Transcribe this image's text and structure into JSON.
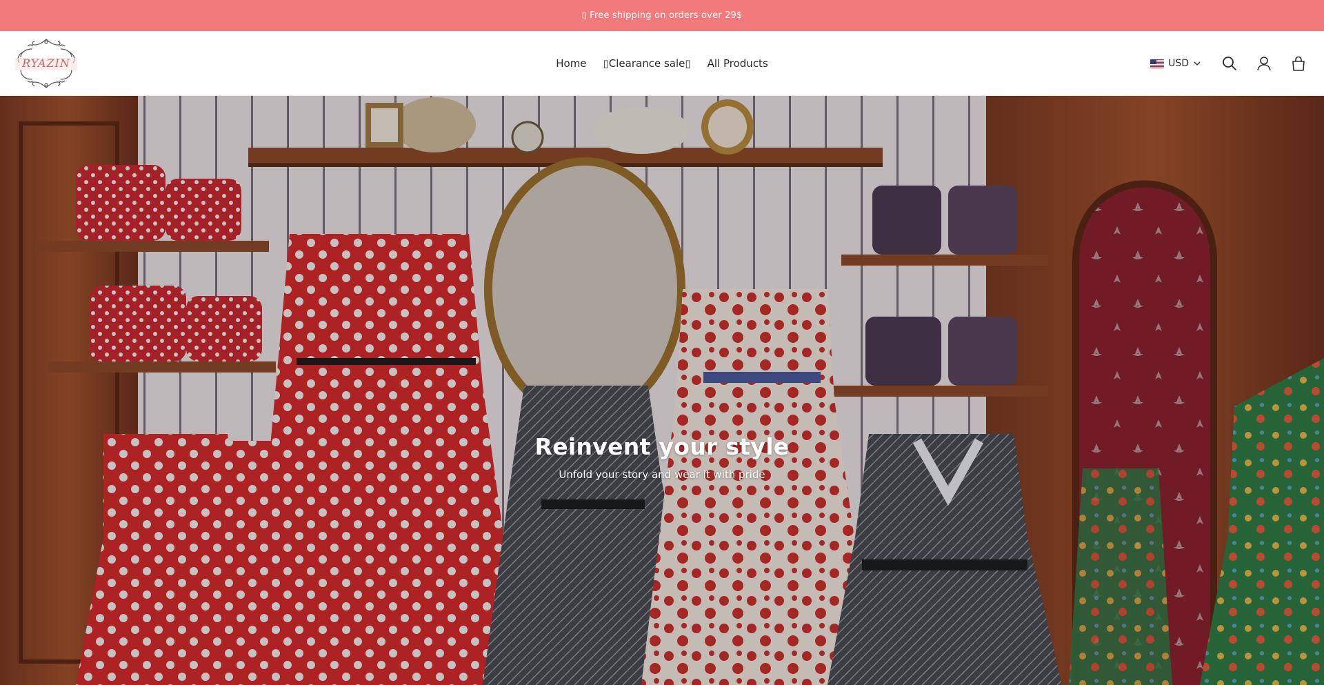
{
  "announcement": {
    "text": "▯ Free shipping on orders over 29$"
  },
  "header": {
    "logo_text": "RYAZIN",
    "nav": [
      {
        "label": "Home"
      },
      {
        "label": "▯Clearance sale▯"
      },
      {
        "label": "All Products"
      }
    ],
    "currency": {
      "flag": "us-flag",
      "code": "USD"
    },
    "icons": [
      "search-icon",
      "account-icon",
      "cart-icon"
    ]
  },
  "hero": {
    "title": "Reinvent your style",
    "subtitle": "Unfold your story and wear it with pride"
  },
  "colors": {
    "announcement_bg": "#f27a7c",
    "text": "#2b2b2b"
  }
}
